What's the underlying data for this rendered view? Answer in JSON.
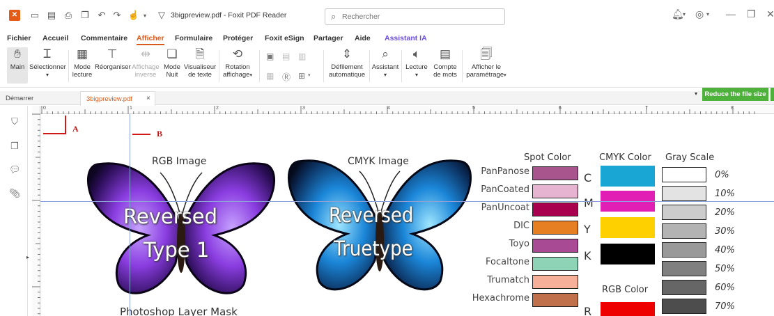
{
  "titlebar": {
    "doc_title": "3bigpreview.pdf - Foxit PDF Reader",
    "search_placeholder": "Rechercher"
  },
  "menu": [
    "Fichier",
    "Accueil",
    "Commentaire",
    "Afficher",
    "Formulaire",
    "Protéger",
    "Foxit eSign",
    "Partager",
    "Aide",
    "Assistant IA"
  ],
  "menu_active": "Afficher",
  "ribbon": {
    "main": "Main",
    "select": "Sélectionner",
    "mode_lecture_1": "Mode",
    "mode_lecture_2": "lecture",
    "reorganiser": "Réorganiser",
    "affichage_inverse_1": "Affichage",
    "affichage_inverse_2": "inverse",
    "mode_nuit_1": "Mode",
    "mode_nuit_2": "Nuit",
    "visualiseur_1": "Visualiseur",
    "visualiseur_2": "de texte",
    "rotation_1": "Rotation",
    "rotation_2": "affichage",
    "defilement_1": "Défilement",
    "defilement_2": "automatique",
    "assistant": "Assistant",
    "lecture": "Lecture",
    "compte_1": "Compte",
    "compte_2": "de mots",
    "afficher_param_1": "Afficher le",
    "afficher_param_2": "paramétrage"
  },
  "tabs": {
    "start": "Démarrer",
    "doc": "3bigpreview.pdf",
    "close": "×"
  },
  "reduce_button": "Reduce the file size",
  "ruler_numbers": [
    "0",
    "1",
    "2",
    "3",
    "4",
    "5",
    "6",
    "7",
    "8"
  ],
  "page": {
    "mark_a": "A",
    "mark_b": "B",
    "rgb_title": "RGB Image",
    "cmyk_title": "CMYK Image",
    "left_overlay_1": "Reversed",
    "left_overlay_2": "Type 1",
    "right_overlay_1": "Reversed",
    "right_overlay_2": "Truetype",
    "bottom_caption": "Photoshop Layer Mask",
    "spot_heading": "Spot Color",
    "cmyk_heading": "CMYK Color",
    "gray_heading": "Gray Scale",
    "rgb_heading": "RGB Color",
    "spot_colors": [
      {
        "label": "PanPanose",
        "color": "#a8558e"
      },
      {
        "label": "PanCoated",
        "color": "#e6b3d1"
      },
      {
        "label": "PanUncoat",
        "color": "#a8004f"
      },
      {
        "label": "DIC",
        "color": "#e67e22"
      },
      {
        "label": "Toyo",
        "color": "#a84a94"
      },
      {
        "label": "Focaltone",
        "color": "#8fd3b7"
      },
      {
        "label": "Trumatch",
        "color": "#f6b09a"
      },
      {
        "label": "Hexachrome",
        "color": "#c0704a"
      }
    ],
    "cmyk_colors": [
      {
        "letter": "C",
        "color": "#1aa6d4"
      },
      {
        "letter": "M",
        "color": "#e21fb5"
      },
      {
        "letter": "Y",
        "color": "#ffd000"
      },
      {
        "letter": "K",
        "color": "#000000"
      }
    ],
    "rgb_colors": [
      {
        "letter": "R",
        "color": "#ee0000"
      }
    ],
    "gray_scale": [
      {
        "pct": "0%",
        "color": "#ffffff"
      },
      {
        "pct": "10%",
        "color": "#e3e3e3"
      },
      {
        "pct": "20%",
        "color": "#cccccc"
      },
      {
        "pct": "30%",
        "color": "#b3b3b3"
      },
      {
        "pct": "40%",
        "color": "#999999"
      },
      {
        "pct": "50%",
        "color": "#808080"
      },
      {
        "pct": "60%",
        "color": "#666666"
      },
      {
        "pct": "70%",
        "color": "#4d4d4d"
      }
    ]
  },
  "colors": {
    "accent": "#d85a1a",
    "reduce_green": "#4eb13c",
    "guide": "#8ea0d8",
    "crop_red": "#d01818"
  }
}
